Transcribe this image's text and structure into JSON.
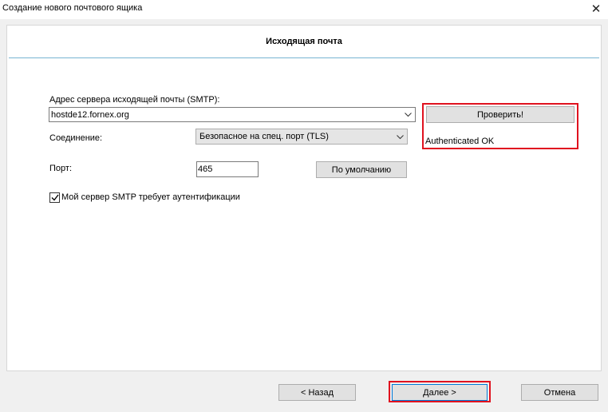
{
  "window": {
    "title": "Создание нового почтового ящика",
    "close_glyph": "✕"
  },
  "header": {
    "title": "Исходящая почта"
  },
  "smtp": {
    "label": "Адрес сервера исходящей почты (SMTP):",
    "value": "hostde12.fornex.org",
    "check_button": "Проверить!",
    "check_status": "Authenticated OK"
  },
  "connection": {
    "label": "Соединение:",
    "selected": "Безопасное на спец. порт (TLS)"
  },
  "port": {
    "label": "Порт:",
    "value": "465",
    "default_button": "По умолчанию"
  },
  "auth": {
    "label": "Мой сервер SMTP требует аутентификации",
    "checked": true
  },
  "footer": {
    "back": "< Назад",
    "next": "Далее  >",
    "cancel": "Отмена"
  },
  "highlight_color": "#e0121f",
  "accent_line_color": "#78b4d2"
}
